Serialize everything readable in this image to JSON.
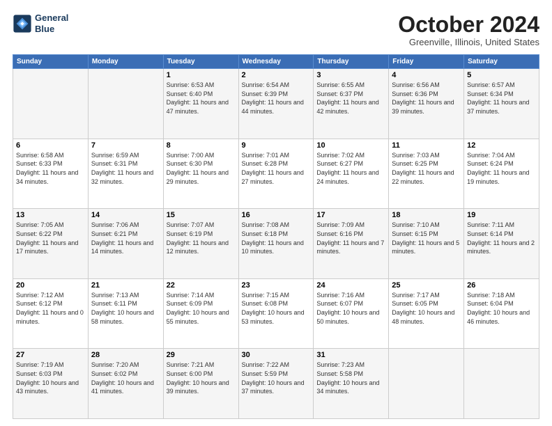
{
  "logo": {
    "line1": "General",
    "line2": "Blue"
  },
  "title": "October 2024",
  "location": "Greenville, Illinois, United States",
  "weekdays": [
    "Sunday",
    "Monday",
    "Tuesday",
    "Wednesday",
    "Thursday",
    "Friday",
    "Saturday"
  ],
  "weeks": [
    [
      {
        "day": "",
        "sunrise": "",
        "sunset": "",
        "daylight": ""
      },
      {
        "day": "",
        "sunrise": "",
        "sunset": "",
        "daylight": ""
      },
      {
        "day": "1",
        "sunrise": "Sunrise: 6:53 AM",
        "sunset": "Sunset: 6:40 PM",
        "daylight": "Daylight: 11 hours and 47 minutes."
      },
      {
        "day": "2",
        "sunrise": "Sunrise: 6:54 AM",
        "sunset": "Sunset: 6:39 PM",
        "daylight": "Daylight: 11 hours and 44 minutes."
      },
      {
        "day": "3",
        "sunrise": "Sunrise: 6:55 AM",
        "sunset": "Sunset: 6:37 PM",
        "daylight": "Daylight: 11 hours and 42 minutes."
      },
      {
        "day": "4",
        "sunrise": "Sunrise: 6:56 AM",
        "sunset": "Sunset: 6:36 PM",
        "daylight": "Daylight: 11 hours and 39 minutes."
      },
      {
        "day": "5",
        "sunrise": "Sunrise: 6:57 AM",
        "sunset": "Sunset: 6:34 PM",
        "daylight": "Daylight: 11 hours and 37 minutes."
      }
    ],
    [
      {
        "day": "6",
        "sunrise": "Sunrise: 6:58 AM",
        "sunset": "Sunset: 6:33 PM",
        "daylight": "Daylight: 11 hours and 34 minutes."
      },
      {
        "day": "7",
        "sunrise": "Sunrise: 6:59 AM",
        "sunset": "Sunset: 6:31 PM",
        "daylight": "Daylight: 11 hours and 32 minutes."
      },
      {
        "day": "8",
        "sunrise": "Sunrise: 7:00 AM",
        "sunset": "Sunset: 6:30 PM",
        "daylight": "Daylight: 11 hours and 29 minutes."
      },
      {
        "day": "9",
        "sunrise": "Sunrise: 7:01 AM",
        "sunset": "Sunset: 6:28 PM",
        "daylight": "Daylight: 11 hours and 27 minutes."
      },
      {
        "day": "10",
        "sunrise": "Sunrise: 7:02 AM",
        "sunset": "Sunset: 6:27 PM",
        "daylight": "Daylight: 11 hours and 24 minutes."
      },
      {
        "day": "11",
        "sunrise": "Sunrise: 7:03 AM",
        "sunset": "Sunset: 6:25 PM",
        "daylight": "Daylight: 11 hours and 22 minutes."
      },
      {
        "day": "12",
        "sunrise": "Sunrise: 7:04 AM",
        "sunset": "Sunset: 6:24 PM",
        "daylight": "Daylight: 11 hours and 19 minutes."
      }
    ],
    [
      {
        "day": "13",
        "sunrise": "Sunrise: 7:05 AM",
        "sunset": "Sunset: 6:22 PM",
        "daylight": "Daylight: 11 hours and 17 minutes."
      },
      {
        "day": "14",
        "sunrise": "Sunrise: 7:06 AM",
        "sunset": "Sunset: 6:21 PM",
        "daylight": "Daylight: 11 hours and 14 minutes."
      },
      {
        "day": "15",
        "sunrise": "Sunrise: 7:07 AM",
        "sunset": "Sunset: 6:19 PM",
        "daylight": "Daylight: 11 hours and 12 minutes."
      },
      {
        "day": "16",
        "sunrise": "Sunrise: 7:08 AM",
        "sunset": "Sunset: 6:18 PM",
        "daylight": "Daylight: 11 hours and 10 minutes."
      },
      {
        "day": "17",
        "sunrise": "Sunrise: 7:09 AM",
        "sunset": "Sunset: 6:16 PM",
        "daylight": "Daylight: 11 hours and 7 minutes."
      },
      {
        "day": "18",
        "sunrise": "Sunrise: 7:10 AM",
        "sunset": "Sunset: 6:15 PM",
        "daylight": "Daylight: 11 hours and 5 minutes."
      },
      {
        "day": "19",
        "sunrise": "Sunrise: 7:11 AM",
        "sunset": "Sunset: 6:14 PM",
        "daylight": "Daylight: 11 hours and 2 minutes."
      }
    ],
    [
      {
        "day": "20",
        "sunrise": "Sunrise: 7:12 AM",
        "sunset": "Sunset: 6:12 PM",
        "daylight": "Daylight: 11 hours and 0 minutes."
      },
      {
        "day": "21",
        "sunrise": "Sunrise: 7:13 AM",
        "sunset": "Sunset: 6:11 PM",
        "daylight": "Daylight: 10 hours and 58 minutes."
      },
      {
        "day": "22",
        "sunrise": "Sunrise: 7:14 AM",
        "sunset": "Sunset: 6:09 PM",
        "daylight": "Daylight: 10 hours and 55 minutes."
      },
      {
        "day": "23",
        "sunrise": "Sunrise: 7:15 AM",
        "sunset": "Sunset: 6:08 PM",
        "daylight": "Daylight: 10 hours and 53 minutes."
      },
      {
        "day": "24",
        "sunrise": "Sunrise: 7:16 AM",
        "sunset": "Sunset: 6:07 PM",
        "daylight": "Daylight: 10 hours and 50 minutes."
      },
      {
        "day": "25",
        "sunrise": "Sunrise: 7:17 AM",
        "sunset": "Sunset: 6:05 PM",
        "daylight": "Daylight: 10 hours and 48 minutes."
      },
      {
        "day": "26",
        "sunrise": "Sunrise: 7:18 AM",
        "sunset": "Sunset: 6:04 PM",
        "daylight": "Daylight: 10 hours and 46 minutes."
      }
    ],
    [
      {
        "day": "27",
        "sunrise": "Sunrise: 7:19 AM",
        "sunset": "Sunset: 6:03 PM",
        "daylight": "Daylight: 10 hours and 43 minutes."
      },
      {
        "day": "28",
        "sunrise": "Sunrise: 7:20 AM",
        "sunset": "Sunset: 6:02 PM",
        "daylight": "Daylight: 10 hours and 41 minutes."
      },
      {
        "day": "29",
        "sunrise": "Sunrise: 7:21 AM",
        "sunset": "Sunset: 6:00 PM",
        "daylight": "Daylight: 10 hours and 39 minutes."
      },
      {
        "day": "30",
        "sunrise": "Sunrise: 7:22 AM",
        "sunset": "Sunset: 5:59 PM",
        "daylight": "Daylight: 10 hours and 37 minutes."
      },
      {
        "day": "31",
        "sunrise": "Sunrise: 7:23 AM",
        "sunset": "Sunset: 5:58 PM",
        "daylight": "Daylight: 10 hours and 34 minutes."
      },
      {
        "day": "",
        "sunrise": "",
        "sunset": "",
        "daylight": ""
      },
      {
        "day": "",
        "sunrise": "",
        "sunset": "",
        "daylight": ""
      }
    ]
  ]
}
